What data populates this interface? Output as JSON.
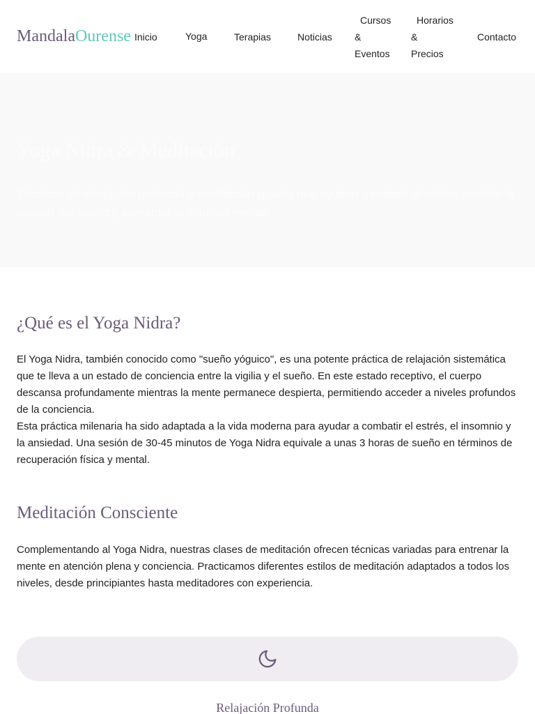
{
  "header": {
    "logo": {
      "part1": "Mandala",
      "part2": "Ourense"
    },
    "nav": {
      "inicio": "Inicio",
      "yoga": "Yoga",
      "terapias": "Terapias",
      "noticias": "Noticias",
      "cursos": [
        "Cursos",
        "&",
        "Eventos"
      ],
      "horarios": [
        "Horarios",
        "&",
        "Precios"
      ],
      "contacto": "Contacto"
    }
  },
  "hero": {
    "title": "Yoga Nidra & Meditación",
    "subtitle": "Técnicas de relajación profunda y meditación guiada que ayudan a reducir el estrés, mejorar la calidad del sueño y aumentar la claridad mental."
  },
  "sections": [
    {
      "title": "¿Qué es el Yoga Nidra?",
      "paragraphs": [
        "El Yoga Nidra, también conocido como \"sueño yóguico\", es una potente práctica de relajación sistemática que te lleva a un estado de conciencia entre la vigilia y el sueño. En este estado receptivo, el cuerpo descansa profundamente mientras la mente permanece despierta, permitiendo acceder a niveles profundos de la conciencia.",
        "Esta práctica milenaria ha sido adaptada a la vida moderna para ayudar a combatir el estrés, el insomnio y la ansiedad. Una sesión de 30-45 minutos de Yoga Nidra equivale a unas 3 horas de sueño en términos de recuperación física y mental."
      ]
    },
    {
      "title": "Meditación Consciente",
      "paragraphs": [
        "Complementando al Yoga Nidra, nuestras clases de meditación ofrecen técnicas variadas para entrenar la mente en atención plena y conciencia. Practicamos diferentes estilos de meditación adaptados a todos los niveles, desde principiantes hasta meditadores con experiencia."
      ]
    }
  ],
  "feature": {
    "icon": "moon-icon",
    "title": "Relajación Profunda"
  },
  "colors": {
    "brand_purple": "#6b5b7b",
    "brand_teal": "#5ec9be",
    "hero_bg": "#f9f9f9",
    "feature_bg": "#efedf1"
  }
}
